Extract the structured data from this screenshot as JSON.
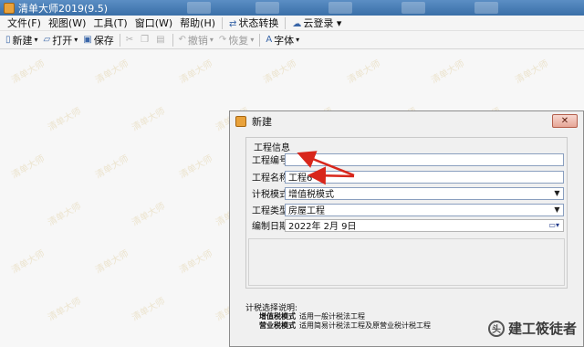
{
  "app": {
    "title": "清单大师2019(9.5)"
  },
  "menu": [
    {
      "label": "文件(F)"
    },
    {
      "label": "视图(W)"
    },
    {
      "label": "工具(T)"
    },
    {
      "label": "窗口(W)"
    },
    {
      "label": "帮助(H)"
    },
    {
      "label": "状态转换"
    },
    {
      "label": "云登录"
    }
  ],
  "toolbar": {
    "new_label": "新建",
    "open_label": "打开",
    "save_label": "保存",
    "undo_label": "撤销",
    "redo_label": "恢复",
    "font_label": "字体"
  },
  "watermark": "清单大师",
  "dialog": {
    "title": "新建",
    "close_glyph": "✕",
    "group_label": "工程信息",
    "fields": {
      "code_label": "工程编号:",
      "code_value": "",
      "name_label": "工程名称:",
      "name_value": "工程6",
      "tax_mode_label": "计税模式:",
      "tax_mode_value": "增值税模式",
      "type_label": "工程类型:",
      "type_value": "房屋工程",
      "date_label": "编制日期:",
      "date_value": "2022年  2月  9日"
    },
    "tax_note_title": "计税选择说明:",
    "tax_notes": [
      {
        "name": "增值税模式",
        "desc": "适用一般计税法工程"
      },
      {
        "name": "营业税模式",
        "desc": "适用简易计税法工程及原营业税计税工程"
      }
    ]
  },
  "brand": {
    "text": "建工筱徒者",
    "logo_text": "头"
  },
  "colors": {
    "arrow": "#d8261b",
    "titlebar": "#3a6fa8"
  }
}
